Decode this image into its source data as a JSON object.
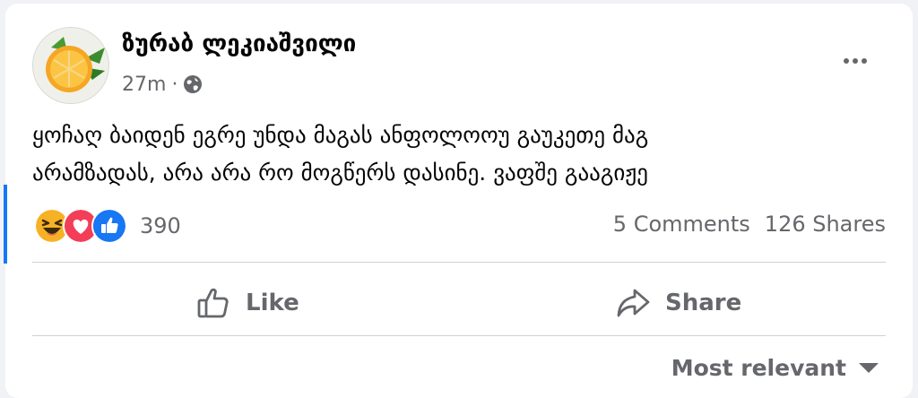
{
  "post": {
    "author": "ზურაბ ლეკიაშვილი",
    "time": "27m",
    "separator": "·",
    "privacy_icon": "globe-icon",
    "more_icon": "more-options-icon",
    "text_lines": [
      "ყოჩაღ ბაიდენ ეგრე უნდა მაგას ანფოლოოუ გაუკეთე მაგ",
      "არამზადას, არა არა რო მოგწერს დასინე. ვაფშე გააგიჟე"
    ]
  },
  "reactions": {
    "icons": [
      "haha-icon",
      "love-icon",
      "like-icon"
    ],
    "count": "390"
  },
  "stats": {
    "comments": "5 Comments",
    "shares": "126 Shares"
  },
  "actions": {
    "like_label": "Like",
    "share_label": "Share"
  },
  "sort": {
    "label": "Most relevant"
  },
  "colors": {
    "accent": "#1877f2",
    "secondary_text": "#65676b",
    "primary_text": "#050505",
    "love": "#f33e58",
    "haha": "#f7b125"
  }
}
